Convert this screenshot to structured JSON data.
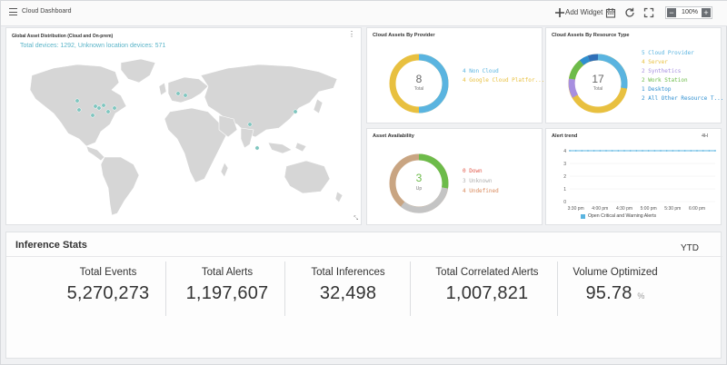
{
  "app": {
    "title": "Cloud Dashboard"
  },
  "toolbar": {
    "add_widget_label": "Add Widget",
    "zoom": "100%",
    "zoom_minus": "−",
    "zoom_plus": "+"
  },
  "map": {
    "title": "Global Asset Distribution (Cloud and On-prem)",
    "summary": "Total devices: 1292, Unknown location devices: 571",
    "menu_glyph": "⋮"
  },
  "provider": {
    "title": "Cloud Assets By Provider",
    "total": "8",
    "total_label": "Total",
    "legend": [
      {
        "text": "4 Non Cloud",
        "color": "#5ab4e0"
      },
      {
        "text": "4 Google Cloud Platfor...",
        "color": "#e8c040"
      }
    ]
  },
  "resource": {
    "title": "Cloud Assets By Resource Type",
    "total": "17",
    "total_label": "Total",
    "legend": [
      {
        "text": "5 Cloud Provider",
        "color": "#5ab4e0"
      },
      {
        "text": "4 Server",
        "color": "#e8c040"
      },
      {
        "text": "2 Synthetics",
        "color": "#a78fe0"
      },
      {
        "text": "2 Work Station",
        "color": "#6dbb4a"
      },
      {
        "text": "1 Desktop",
        "color": "#2f8fd0"
      },
      {
        "text": "2 All Other Resource T...",
        "color": "#2f8fd0"
      }
    ]
  },
  "availability": {
    "title": "Asset Availability",
    "total": "3",
    "total_label": "Up",
    "legend": [
      {
        "text": "0 Down",
        "color": "#e2584a"
      },
      {
        "text": "3 Unknown",
        "color": "#b8b8b8"
      },
      {
        "text": "4 Undefined",
        "color": "#d98a5c"
      }
    ]
  },
  "alert_trend": {
    "title": "Alert trend",
    "range": "4H",
    "legend_label": "Open Critical and Warning Alerts",
    "series_color": "#5ab4e0"
  },
  "chart_data": {
    "type": "line",
    "title": "Alert trend",
    "x": [
      "3:30 pm",
      "4:00 pm",
      "4:30 pm",
      "5:00 pm",
      "5:30 pm",
      "6:00 pm",
      "6:30 pm"
    ],
    "y_ticks": [
      0,
      1,
      2,
      3,
      4
    ],
    "ylim": [
      0,
      4
    ],
    "series": [
      {
        "name": "Open Critical and Warning Alerts",
        "values": [
          4,
          4,
          4,
          4,
          4,
          4,
          4,
          4,
          4,
          4,
          4,
          4,
          4,
          4,
          4,
          4,
          4,
          4,
          4,
          4,
          4,
          4,
          4,
          4,
          4
        ]
      }
    ],
    "x_label_indices": [
      1,
      5,
      9,
      13,
      17,
      21
    ]
  },
  "inference": {
    "title": "Inference Stats",
    "period": "YTD",
    "stats": [
      {
        "label": "Total Events",
        "value": "5,270,273",
        "unit": ""
      },
      {
        "label": "Total Alerts",
        "value": "1,197,607",
        "unit": ""
      },
      {
        "label": "Total Inferences",
        "value": "32,498",
        "unit": ""
      },
      {
        "label": "Total Correlated Alerts",
        "value": "1,007,821",
        "unit": ""
      },
      {
        "label": "Volume Optimized",
        "value": "95.78",
        "unit": "%"
      }
    ]
  }
}
